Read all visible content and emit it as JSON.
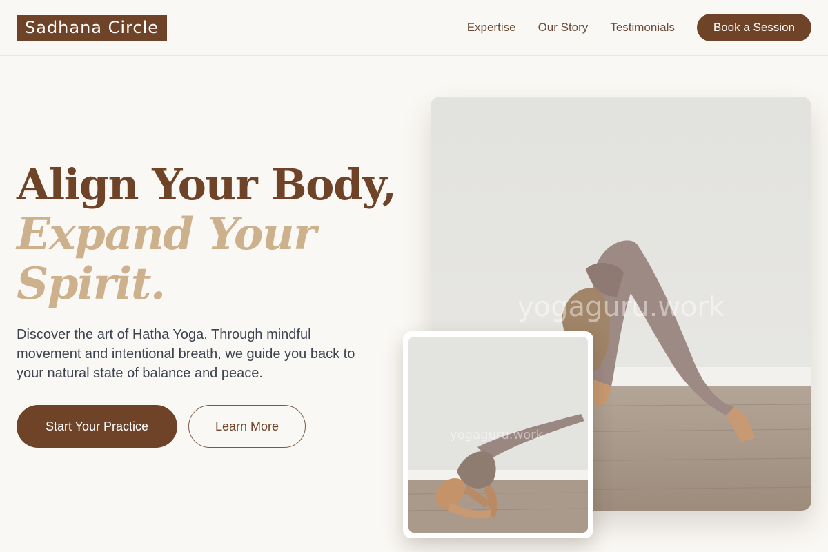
{
  "header": {
    "logo": "Sadhana Circle",
    "nav": [
      "Expertise",
      "Our Story",
      "Testimonials"
    ],
    "cta": "Book a Session"
  },
  "hero": {
    "headline_line1": "Align Your Body,",
    "headline_line2": "Expand Your Spirit.",
    "description": "Discover the art of Hatha Yoga. Through mindful movement and intentional breath, we guide you back to your natural state of balance and peace.",
    "primary_button": "Start Your Practice",
    "secondary_button": "Learn More"
  },
  "images": {
    "main_watermark": "yogaguru.work",
    "small_watermark": "yogaguru.work"
  },
  "colors": {
    "brand_brown": "#6f4327",
    "accent_tan": "#cdb08c",
    "background": "#faf8f4"
  }
}
